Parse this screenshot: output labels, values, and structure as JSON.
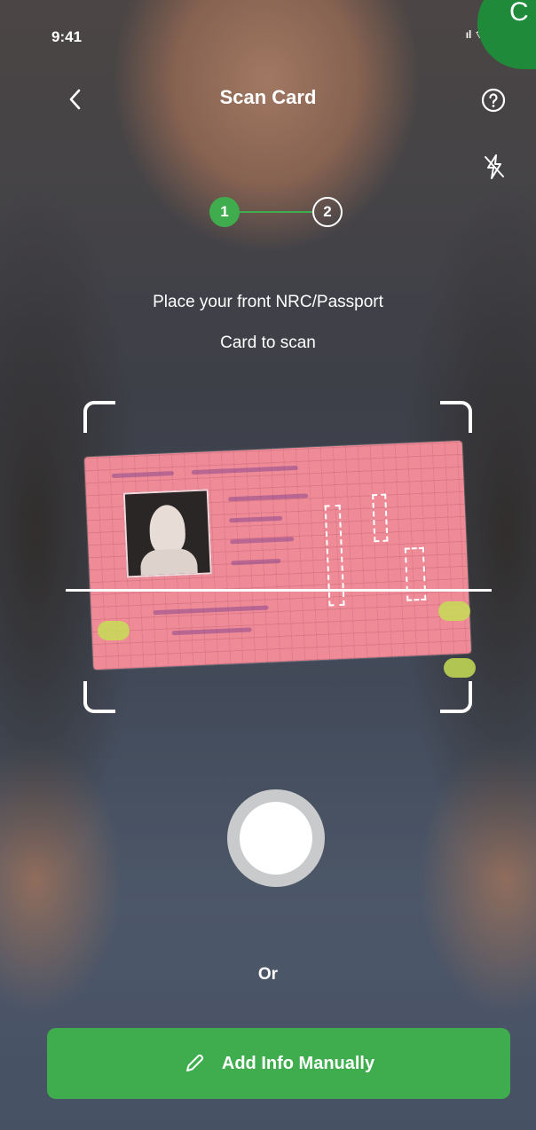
{
  "status_bar": {
    "time": "9:41",
    "indicators": "ıl ⌔"
  },
  "corner_badge": {
    "text": "C"
  },
  "header": {
    "title": "Scan Card",
    "back_icon": "chevron-left-icon",
    "help_icon": "question-circle-icon",
    "flash_icon": "flash-off-icon"
  },
  "stepper": {
    "steps": [
      {
        "label": "1",
        "state": "active"
      },
      {
        "label": "2",
        "state": "inactive"
      }
    ]
  },
  "instruction": {
    "line1": "Place your front NRC/Passport",
    "line2": "Card to scan"
  },
  "or_label": "Or",
  "manual_button": {
    "label": "Add Info Manually",
    "icon": "pencil-icon"
  },
  "colors": {
    "accent_green": "#3fad4e",
    "card_pink": "#ee8b97",
    "text": "#ffffff"
  }
}
